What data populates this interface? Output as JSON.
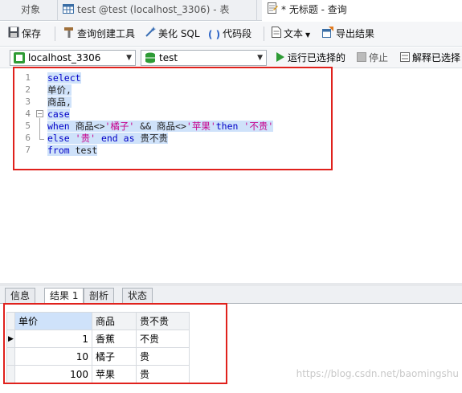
{
  "tabs": [
    {
      "label": "对象"
    },
    {
      "label": "test @test (localhost_3306) - 表"
    },
    {
      "label": "* 无标题 - 查询"
    }
  ],
  "toolbar": {
    "save": "保存",
    "query_builder": "查询创建工具",
    "beautify": "美化 SQL",
    "code_snippet": "代码段",
    "text": "文本",
    "export": "导出结果"
  },
  "connection": {
    "server": "localhost_3306",
    "database": "test",
    "run_selected": "运行已选择的",
    "stop": "停止",
    "explain": "解释已选择"
  },
  "editor": {
    "lines": [
      {
        "n": "1",
        "tokens": [
          {
            "t": "select",
            "c": "kw"
          }
        ]
      },
      {
        "n": "2",
        "tokens": [
          {
            "t": "单价,",
            "c": "plain"
          }
        ]
      },
      {
        "n": "3",
        "tokens": [
          {
            "t": "商品,",
            "c": "plain"
          }
        ]
      },
      {
        "n": "4",
        "tokens": [
          {
            "t": "case",
            "c": "kw"
          }
        ]
      },
      {
        "n": "5",
        "tokens": [
          {
            "t": "when",
            "c": "kw"
          },
          {
            "t": " 商品<>",
            "c": "plain"
          },
          {
            "t": "'橘子'",
            "c": "str"
          },
          {
            "t": " && 商品<>",
            "c": "plain"
          },
          {
            "t": "'苹果'",
            "c": "str"
          },
          {
            "t": "then",
            "c": "kw"
          },
          {
            "t": " ",
            "c": "plain"
          },
          {
            "t": "'不贵'",
            "c": "str"
          }
        ]
      },
      {
        "n": "6",
        "tokens": [
          {
            "t": "else",
            "c": "kw"
          },
          {
            "t": " ",
            "c": "plain"
          },
          {
            "t": "'贵'",
            "c": "str"
          },
          {
            "t": " ",
            "c": "plain"
          },
          {
            "t": "end",
            "c": "kw"
          },
          {
            "t": " ",
            "c": "plain"
          },
          {
            "t": "as",
            "c": "kw"
          },
          {
            "t": " 贵不贵",
            "c": "plain"
          }
        ]
      },
      {
        "n": "7",
        "tokens": [
          {
            "t": "from",
            "c": "kw"
          },
          {
            "t": " test",
            "c": "plain"
          }
        ]
      }
    ]
  },
  "result_tabs": [
    {
      "label": "信息"
    },
    {
      "label": "结果 1"
    },
    {
      "label": "剖析"
    },
    {
      "label": "状态"
    }
  ],
  "result": {
    "columns": [
      "单价",
      "商品",
      "贵不贵"
    ],
    "rows": [
      [
        "1",
        "香蕉",
        "不贵"
      ],
      [
        "10",
        "橘子",
        "贵"
      ],
      [
        "100",
        "苹果",
        "贵"
      ]
    ]
  },
  "watermark": "https://blog.csdn.net/baomingshu",
  "colors": {
    "keyword": "#0000c8",
    "string": "#c8008c",
    "highlight": "#cfe2fa",
    "annotation": "#e0211c"
  }
}
